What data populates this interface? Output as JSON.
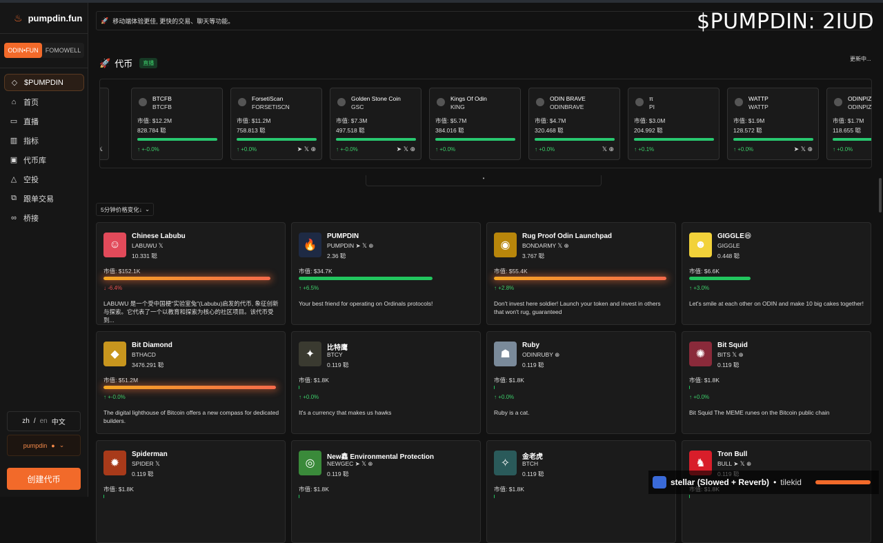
{
  "app": {
    "name": "pumpdin.fun",
    "overlay_title": "$PUMPDIN: 2IUD"
  },
  "sidebar": {
    "tabs": [
      {
        "label": "ODIN•FUN"
      },
      {
        "label": "FOMOWELL"
      }
    ],
    "items": [
      {
        "label": "$PUMPDIN",
        "icon": "diamond-icon",
        "glyph": "◇"
      },
      {
        "label": "首页",
        "icon": "home-icon",
        "glyph": "⌂"
      },
      {
        "label": "直播",
        "icon": "video-icon",
        "glyph": "▭"
      },
      {
        "label": "指标",
        "icon": "chart-icon",
        "glyph": "▥"
      },
      {
        "label": "代币库",
        "icon": "token-library-icon",
        "glyph": "▣"
      },
      {
        "label": "空投",
        "icon": "airdrop-icon",
        "glyph": "△"
      },
      {
        "label": "跟单交易",
        "icon": "copy-trade-icon",
        "glyph": "⧉"
      },
      {
        "label": "桥接",
        "icon": "link-icon",
        "glyph": "∞"
      }
    ],
    "lang": {
      "zh": "zh",
      "sep": "/",
      "en": "en",
      "chinese": "中文"
    },
    "user": {
      "name": "pumpdin"
    },
    "create_label": "创建代币"
  },
  "banner": {
    "text": "移动端体验更佳, 更快的交易、聊天等功能。"
  },
  "section": {
    "title": "代币",
    "live": "直播",
    "updating": "更新中..."
  },
  "strip": {
    "handle": "•",
    "tokens": [
      {
        "name": "",
        "ticker": "",
        "mcap": "",
        "holders": "",
        "change": "",
        "progress": 1.0,
        "socials": "𝕏"
      },
      {
        "name": "BTCFB",
        "ticker": "BTCFB",
        "mcap": "市值: $12.2M",
        "holders": "828.784 聪",
        "change": "↑ +-0.0%",
        "progress": 1.0,
        "socials": ""
      },
      {
        "name": "ForsetiScan",
        "ticker": "FORSETISCN",
        "mcap": "市值: $11.2M",
        "holders": "758.813 聪",
        "change": "↑ +0.0%",
        "progress": 1.0,
        "socials": "➤ 𝕏 ⊕"
      },
      {
        "name": "Golden Stone Coin",
        "ticker": "GSC",
        "mcap": "市值: $7.3M",
        "holders": "497.518 聪",
        "change": "↑ +-0.0%",
        "progress": 1.0,
        "socials": "➤ 𝕏 ⊕"
      },
      {
        "name": "Kings Of Odin",
        "ticker": "KING",
        "mcap": "市值: $5.7M",
        "holders": "384.016 聪",
        "change": "↑ +0.0%",
        "progress": 1.0,
        "socials": ""
      },
      {
        "name": "ODIN BRAVE",
        "ticker": "ODINBRAVE",
        "mcap": "市值: $4.7M",
        "holders": "320.468 聪",
        "change": "↑ +0.0%",
        "progress": 1.0,
        "socials": "𝕏 ⊕"
      },
      {
        "name": "π",
        "ticker": "PI",
        "mcap": "市值: $3.0M",
        "holders": "204.992 聪",
        "change": "↑ +0.1%",
        "progress": 1.0,
        "socials": ""
      },
      {
        "name": "WATTP",
        "ticker": "WATTP",
        "mcap": "市值: $1.9M",
        "holders": "128.572 聪",
        "change": "↑ +0.0%",
        "progress": 1.0,
        "socials": "➤ 𝕏 ⊕"
      },
      {
        "name": "ODINPIZZ",
        "ticker": "ODINPIZZ",
        "mcap": "市值: $1.7M",
        "holders": "118.655 聪",
        "change": "↑ +0.0%",
        "progress": 1.0,
        "socials": ""
      }
    ]
  },
  "sort": {
    "label": "5分钟价格变化↓"
  },
  "cards": [
    {
      "name": "Chinese Labubu",
      "ticker": "LABUWU 𝕏",
      "holders": "10.331 聪",
      "mcap": "市值: $152.1K",
      "change": "↓ -6.4%",
      "dir": "down",
      "progress": 0.95,
      "bar": "orange",
      "desc": "LABUWU 是一个受中国梗\"实验室兔\"(Labubu)启发的代币, 象征创新与探索。它代表了一个以教育和探索为核心的社区项目。该代币受到...",
      "img_color": "#e24a5a",
      "glyph": "☺"
    },
    {
      "name": "PUMPDIN",
      "ticker": "PUMPDIN ➤ 𝕏 ⊕",
      "holders": "2.36 聪",
      "mcap": "市值: $34.7K",
      "change": "↑ +6.5%",
      "dir": "up",
      "progress": 0.76,
      "bar": "green",
      "desc": "Your best friend for operating on Ordinals protocols!",
      "img_color": "#1e2a44",
      "glyph": "🔥"
    },
    {
      "name": "Rug Proof Odin Launchpad",
      "ticker": "BONDARMY 𝕏 ⊕",
      "holders": "3.767 聪",
      "mcap": "市值: $55.4K",
      "change": "↑ +2.8%",
      "dir": "up",
      "progress": 0.98,
      "bar": "orange",
      "desc": "Don't invest here soldier! Launch your token and invest in others that won't rug, guaranteed",
      "img_color": "#b8860b",
      "glyph": "◉"
    },
    {
      "name": "GIGGLE😆",
      "ticker": "GIGGLE",
      "holders": "0.448 聪",
      "mcap": "市值: $6.6K",
      "change": "↑ +3.0%",
      "dir": "up",
      "progress": 0.35,
      "bar": "green",
      "desc": "Let's smile at each other on ODIN and make 10 big cakes together!",
      "img_color": "#f2d23a",
      "glyph": "☻"
    },
    {
      "name": "Bit Diamond",
      "ticker": "BTHACD",
      "holders": "3476.291 聪",
      "mcap": "市值: $51.2M",
      "change": "↑ +-0.0%",
      "dir": "up",
      "progress": 0.98,
      "bar": "orange",
      "desc": "The digital lighthouse of Bitcoin offers a new compass for dedicated builders.",
      "img_color": "#c8961e",
      "glyph": "◆"
    },
    {
      "name": "比特鹰",
      "ticker": "BTCY",
      "holders": "0.119 聪",
      "mcap": "市值: $1.8K",
      "change": "↑ +0.0%",
      "dir": "up",
      "progress": 0.004,
      "bar": "green",
      "desc": "It's a currency that makes us hawks",
      "img_color": "#3a3a30",
      "glyph": "✦"
    },
    {
      "name": "Ruby",
      "ticker": "ODINRUBY ⊕",
      "holders": "0.119 聪",
      "mcap": "市值: $1.8K",
      "change": "↑ +0.0%",
      "dir": "up",
      "progress": 0.004,
      "bar": "green",
      "desc": "Ruby is a cat.",
      "img_color": "#7a8a9a",
      "glyph": "☗"
    },
    {
      "name": "Bit Squid",
      "ticker": "BITS 𝕏 ⊕",
      "holders": "0.119 聪",
      "mcap": "市值: $1.8K",
      "change": "↑ +0.0%",
      "dir": "up",
      "progress": 0.004,
      "bar": "green",
      "desc": "Bit Squid The MEME runes on the Bitcoin public chain",
      "img_color": "#8a2a3a",
      "glyph": "✺"
    },
    {
      "name": "Spiderman",
      "ticker": "SPIDER 𝕏",
      "holders": "0.119 聪",
      "mcap": "市值: $1.8K",
      "change": "",
      "dir": "up",
      "progress": 0.004,
      "bar": "green",
      "desc": "",
      "img_color": "#a83a1a",
      "glyph": "✹"
    },
    {
      "name": "New鑫 Environmental Protection",
      "ticker": "NEWGEC ➤ 𝕏 ⊕",
      "holders": "0.119 聪",
      "mcap": "市值: $1.8K",
      "change": "",
      "dir": "up",
      "progress": 0.004,
      "bar": "green",
      "desc": "",
      "img_color": "#3a8a3a",
      "glyph": "◎"
    },
    {
      "name": "金老虎",
      "ticker": "BTCH",
      "holders": "0.119 聪",
      "mcap": "市值: $1.8K",
      "change": "",
      "dir": "up",
      "progress": 0.004,
      "bar": "green",
      "desc": "",
      "img_color": "#2a5a5a",
      "glyph": "✧"
    },
    {
      "name": "Tron Bull",
      "ticker": "BULL ➤ 𝕏 ⊕",
      "holders": "0.119 聪",
      "mcap": "市值: $1.8K",
      "change": "",
      "dir": "up",
      "progress": 0.004,
      "bar": "green",
      "desc": "",
      "img_color": "#d81e2a",
      "glyph": "♞"
    }
  ],
  "player": {
    "title": "stellar (Slowed + Reverb)",
    "dot": "•",
    "artist": "tilekid"
  }
}
